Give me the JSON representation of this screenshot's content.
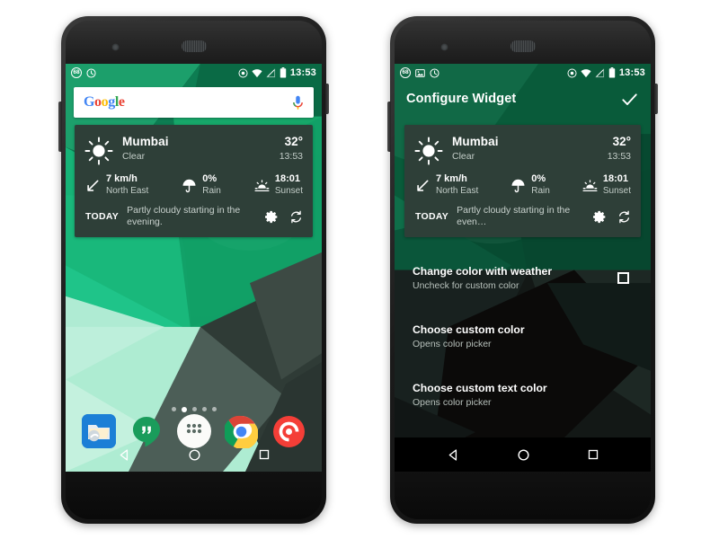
{
  "phones": [
    {
      "id": "left",
      "screen_name": "Android home screen with weather widget",
      "status_bar": {
        "notification_icons": [
          "badge-68-icon",
          "clock-icon"
        ],
        "system_icons": [
          "location-target-icon",
          "wifi-icon",
          "signal-off-icon",
          "battery-icon"
        ],
        "badge_text": "68",
        "clock": "13:53"
      },
      "search": {
        "logo_letters": [
          "G",
          "o",
          "o",
          "g",
          "l",
          "e"
        ],
        "mic_icon": "microphone-icon"
      },
      "widget": {
        "city": "Mumbai",
        "condition": "Clear",
        "temperature": "32°",
        "time": "13:53",
        "metrics": [
          {
            "icon": "wind-arrow-icon",
            "value": "7 km/h",
            "label": "North East"
          },
          {
            "icon": "umbrella-icon",
            "value": "0%",
            "label": "Rain"
          },
          {
            "icon": "sunset-icon",
            "value": "18:01",
            "label": "Sunset"
          }
        ],
        "forecast_label": "TODAY",
        "forecast_text": "Partly cloudy starting in the evening.",
        "actions": [
          "settings-gear-icon",
          "refresh-icon"
        ]
      },
      "page_dots": {
        "count": 5,
        "active_index": 1
      },
      "dock": [
        {
          "name": "solid-explorer",
          "icon": "file-manager-icon"
        },
        {
          "name": "hangouts",
          "icon": "chat-bubble-icon"
        },
        {
          "name": "app-drawer",
          "icon": "grid-dots-icon"
        },
        {
          "name": "chrome",
          "icon": "chrome-icon"
        },
        {
          "name": "pocket-casts",
          "icon": "podcast-icon"
        }
      ],
      "nav": [
        "back-icon",
        "home-icon",
        "recents-icon"
      ]
    },
    {
      "id": "right",
      "screen_name": "Configure Widget settings screen",
      "status_bar": {
        "notification_icons": [
          "badge-68-icon",
          "image-icon",
          "clock-icon"
        ],
        "system_icons": [
          "location-target-icon",
          "wifi-icon",
          "signal-off-icon",
          "battery-icon"
        ],
        "badge_text": "68",
        "clock": "13:53"
      },
      "appbar": {
        "title": "Configure Widget",
        "confirm_icon": "checkmark-icon"
      },
      "widget": {
        "city": "Mumbai",
        "condition": "Clear",
        "temperature": "32°",
        "time": "13:53",
        "metrics": [
          {
            "icon": "wind-arrow-icon",
            "value": "7 km/h",
            "label": "North East"
          },
          {
            "icon": "umbrella-icon",
            "value": "0%",
            "label": "Rain"
          },
          {
            "icon": "sunset-icon",
            "value": "18:01",
            "label": "Sunset"
          }
        ],
        "forecast_label": "TODAY",
        "forecast_text": "Partly cloudy starting in the even…",
        "actions": [
          "settings-gear-icon",
          "refresh-icon"
        ]
      },
      "settings": [
        {
          "title": "Change color with weather",
          "subtitle": "Uncheck for custom color",
          "control": "checkbox",
          "checked": false
        },
        {
          "title": "Choose custom color",
          "subtitle": "Opens color picker",
          "control": "none"
        },
        {
          "title": "Choose custom text color",
          "subtitle": "Opens color picker",
          "control": "none"
        }
      ],
      "nav": [
        "back-icon",
        "home-icon",
        "recents-icon"
      ]
    }
  ],
  "colors": {
    "widget_bg": "#2e3f38",
    "widget_text": "#ffffff",
    "widget_subtext": "#c3cdc8",
    "status_bar_text": "#ffffff",
    "wallpaper_green": "#0e9b62",
    "wallpaper_dark": "#2b2f2c",
    "wallpaper_mint": "#a8e8cf",
    "page_bg": "#ffffff"
  }
}
